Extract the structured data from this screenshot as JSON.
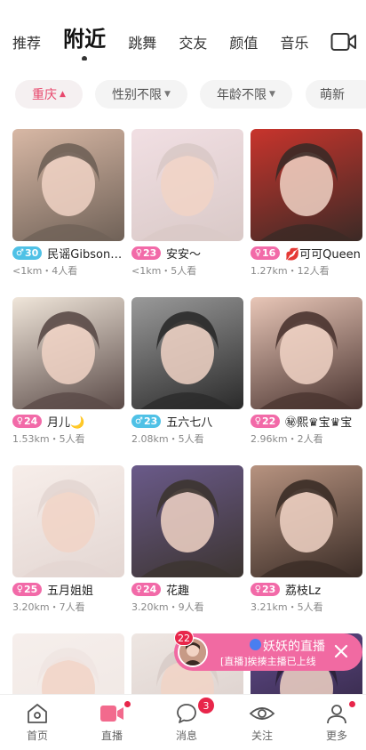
{
  "tabs": [
    "推荐",
    "附近",
    "跳舞",
    "交友",
    "颜值",
    "音乐"
  ],
  "active_tab": 1,
  "filters": [
    {
      "label": "重庆",
      "active": true
    },
    {
      "label": "性别不限",
      "active": false
    },
    {
      "label": "年龄不限",
      "active": false
    },
    {
      "label": "萌新",
      "active": false
    }
  ],
  "cards": [
    {
      "gender": "male",
      "symbol": "♂",
      "age": "30",
      "name": "民谣Gibson🎸",
      "meta": "<1km・4人看",
      "bg": [
        "#6f6157",
        "#d8b8a5"
      ]
    },
    {
      "gender": "female",
      "symbol": "♀",
      "age": "23",
      "name": "安安～",
      "meta": "<1km・5人看",
      "bg": [
        "#d9c9c7",
        "#f1dfe3"
      ]
    },
    {
      "gender": "female",
      "symbol": "♀",
      "age": "16",
      "name": "💋可可Queen",
      "meta": "1.27km・12人看",
      "bg": [
        "#3b2a26",
        "#c8342c"
      ]
    },
    {
      "gender": "female",
      "symbol": "♀",
      "age": "24",
      "name": "月儿🌙",
      "meta": "1.53km・5人看",
      "bg": [
        "#5a4a47",
        "#f0e6da"
      ]
    },
    {
      "gender": "male",
      "symbol": "♂",
      "age": "23",
      "name": "五六七八",
      "meta": "2.08km・5人看",
      "bg": [
        "#2a2a2a",
        "#9a9a9a"
      ]
    },
    {
      "gender": "female",
      "symbol": "♀",
      "age": "22",
      "name": "㊙熙♛宝♛宝",
      "meta": "2.96km・2人看",
      "bg": [
        "#4a3430",
        "#e8c6b7"
      ]
    },
    {
      "gender": "female",
      "symbol": "♀",
      "age": "25",
      "name": "五月姐姐",
      "meta": "3.20km・7人看",
      "bg": [
        "#e3d6d2",
        "#f7eeea"
      ]
    },
    {
      "gender": "female",
      "symbol": "♀",
      "age": "24",
      "name": "花趣",
      "meta": "3.20km・9人看",
      "bg": [
        "#3c3430",
        "#6a5a8a"
      ]
    },
    {
      "gender": "female",
      "symbol": "♀",
      "age": "23",
      "name": "荔枝Lz",
      "meta": "3.21km・5人看",
      "bg": [
        "#3a2c26",
        "#b79380"
      ]
    },
    {
      "gender": "female",
      "symbol": "♀",
      "age": "",
      "name": "",
      "meta": "",
      "bg": [
        "#efe6e2",
        "#f6efec"
      ]
    },
    {
      "gender": "female",
      "symbol": "♀",
      "age": "",
      "name": "",
      "meta": "",
      "bg": [
        "#d8ccc8",
        "#eee6e2"
      ]
    },
    {
      "gender": "female",
      "symbol": "♀",
      "age": "",
      "name": "",
      "meta": "",
      "bg": [
        "#2a2036",
        "#604a8a"
      ]
    }
  ],
  "live_popup": {
    "count": "22",
    "title": "妖妖的直播间",
    "text": "[直播]挨揍主播已上线"
  },
  "nav": [
    {
      "label": "首页",
      "icon": "home-icon",
      "active": false
    },
    {
      "label": "直播",
      "icon": "live-camera-icon",
      "active": true
    },
    {
      "label": "消息",
      "icon": "message-icon",
      "active": false,
      "badge": "3"
    },
    {
      "label": "关注",
      "icon": "eye-icon",
      "active": false
    },
    {
      "label": "更多",
      "icon": "profile-icon",
      "active": false
    }
  ],
  "colors": {
    "accent": "#e8486d",
    "male": "#4fc1e6",
    "female": "#f26aa8",
    "badge_red": "#e8264a",
    "popup": "#f16aa2"
  }
}
